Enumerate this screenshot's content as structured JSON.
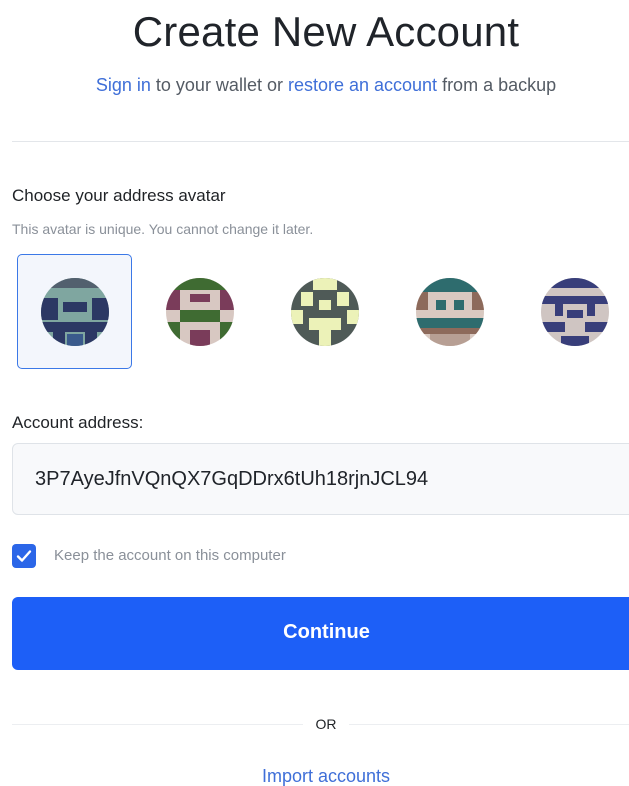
{
  "header": {
    "title": "Create New Account",
    "subtitle_link_signin": "Sign in",
    "subtitle_text_mid": " to your wallet or ",
    "subtitle_link_restore": "restore an account",
    "subtitle_text_end": " from a backup"
  },
  "avatar_section": {
    "title": "Choose your address avatar",
    "hint": "This avatar is unique. You cannot change it later.",
    "selected_index": 0,
    "avatars": [
      {
        "icon": "identicon-avatar-1",
        "bg": "#7fa6a0",
        "fg": "#2c3864"
      },
      {
        "icon": "identicon-avatar-2",
        "bg": "#d8c8c2",
        "fg": "#3f6b32",
        "accent": "#7a3c5a"
      },
      {
        "icon": "identicon-avatar-3",
        "bg": "#ecf2b8",
        "fg": "#4f5a57"
      },
      {
        "icon": "identicon-avatar-4",
        "bg": "#d9c9c1",
        "fg": "#2e6c6e",
        "accent": "#8d6a5b"
      },
      {
        "icon": "identicon-avatar-5",
        "bg": "#cfc5c2",
        "fg": "#383e7a"
      }
    ]
  },
  "address": {
    "label": "Account address:",
    "value": "3P7AyeJfnVQnQX7GqDDrx6tUh18rjnJCL94"
  },
  "keep_account": {
    "checked": true,
    "label": "Keep the account on this computer"
  },
  "continue_button": {
    "label": "Continue",
    "color": "#1d5ff7"
  },
  "divider_or": "OR",
  "import_link": "Import accounts",
  "colors": {
    "link": "#3f6fd8",
    "accent": "#1d5ff7"
  }
}
